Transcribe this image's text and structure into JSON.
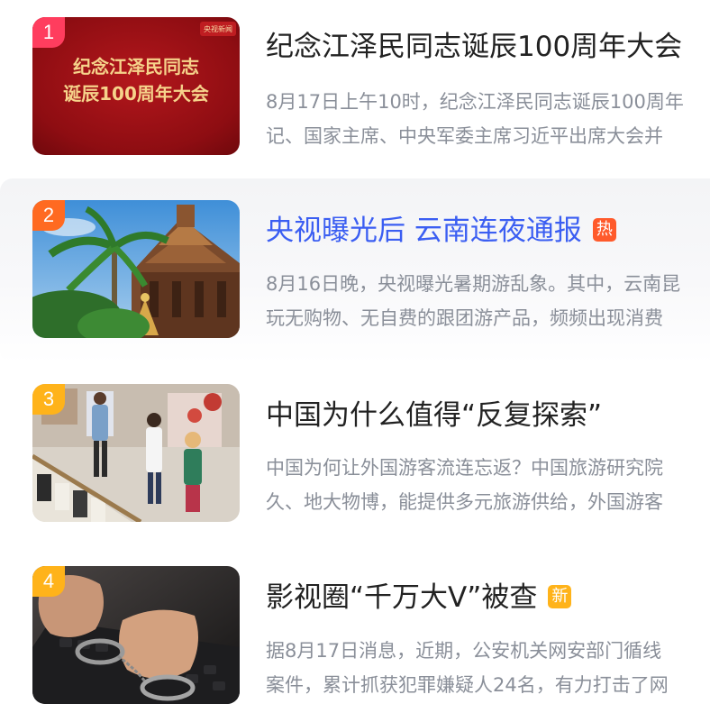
{
  "colors": {
    "rank_1": "#ff3d5e",
    "rank_2": "#ff6a21",
    "rank_3": "#ffb31a",
    "rank_4": "#ffb31a",
    "title_highlight": "#3b5ef2",
    "hot_tag": "#ff5a2b",
    "new_tag": "#ffb31a"
  },
  "items": [
    {
      "rank": "1",
      "title": "纪念江泽民同志诞辰100周年大会",
      "thumb_logo": "央视新闻",
      "thumb_line1": "纪念江泽民同志",
      "thumb_line2": "诞辰100周年大会",
      "desc_line1": "8月17日上午10时，纪念江泽民同志诞辰100周年",
      "desc_line2": "记、国家主席、中央军委主席习近平出席大会并"
    },
    {
      "rank": "2",
      "title": "央视曝光后 云南连夜通报",
      "tag": "热",
      "tag_icon": "hot-tag-icon",
      "desc_line1": "8月16日晚，央视曝光暑期游乱象。其中，云南昆",
      "desc_line2": "玩无购物、无自费的跟团游产品，频频出现消费"
    },
    {
      "rank": "3",
      "title": "中国为什么值得“反复探索”",
      "desc_line1": "中国为何让外国游客流连忘返？中国旅游研究院",
      "desc_line2": "久、地大物博，能提供多元旅游供给，外国游客"
    },
    {
      "rank": "4",
      "title": "影视圈“千万大V”被查",
      "tag": "新",
      "tag_icon": "new-tag-icon",
      "desc_line1": "据8月17日消息，近期，公安机关网安部门循线",
      "desc_line2": "案件，累计抓获犯罪嫌疑人24名，有力打击了网"
    }
  ]
}
